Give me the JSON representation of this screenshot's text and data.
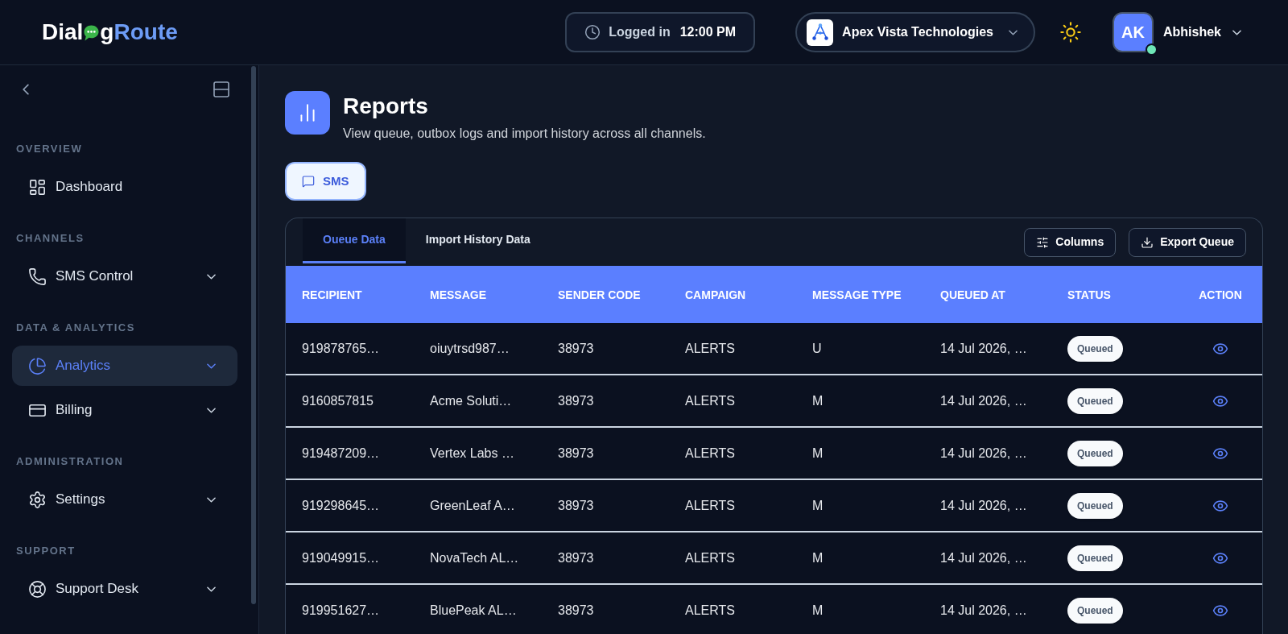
{
  "header": {
    "logo": {
      "lead": "Dial",
      "tail": "g",
      "accent": "Route"
    },
    "session": {
      "label": "Logged in",
      "time": "12:00 PM"
    },
    "organization": {
      "name": "Apex Vista Technologies"
    },
    "user": {
      "initials": "AK",
      "name": "Abhishek",
      "online": true
    }
  },
  "sidebar": {
    "sections": [
      {
        "title": "OVERVIEW",
        "items": [
          {
            "kind": "dashboard",
            "label": "Dashboard",
            "selected": false,
            "expandable": false
          }
        ]
      },
      {
        "title": "CHANNELS",
        "items": [
          {
            "kind": "phone",
            "label": "SMS Control",
            "selected": false,
            "expandable": true
          }
        ]
      },
      {
        "title": "DATA & ANALYTICS",
        "items": [
          {
            "kind": "pie-chart",
            "label": "Analytics",
            "selected": true,
            "expandable": true
          },
          {
            "kind": "credit-card",
            "label": "Billing",
            "selected": false,
            "expandable": true
          }
        ]
      },
      {
        "title": "ADMINISTRATION",
        "items": [
          {
            "kind": "gear",
            "label": "Settings",
            "selected": false,
            "expandable": true
          }
        ]
      },
      {
        "title": "SUPPORT",
        "items": [
          {
            "kind": "lifebuoy",
            "label": "Support Desk",
            "selected": false,
            "expandable": true
          }
        ]
      }
    ]
  },
  "page": {
    "title": "Reports",
    "subtitle": "View queue, outbox logs and import history across all channels."
  },
  "channels": [
    {
      "label": "SMS",
      "selected": true
    }
  ],
  "report_tabs": [
    {
      "label": "Oueue Data",
      "selected": true
    },
    {
      "label": "Import History Data",
      "selected": false
    }
  ],
  "toolbar": [
    {
      "kind": "columns",
      "label": "Columns"
    },
    {
      "kind": "export",
      "label": "Export Queue"
    }
  ],
  "table": {
    "columns": [
      {
        "label": "RECIPIENT",
        "kind": "text"
      },
      {
        "label": "MESSAGE",
        "kind": "text"
      },
      {
        "label": "SENDER CODE",
        "kind": "text"
      },
      {
        "label": "CAMPAIGN",
        "kind": "text"
      },
      {
        "label": "MESSAGE TYPE",
        "kind": "text"
      },
      {
        "label": "QUEUED AT",
        "kind": "text"
      },
      {
        "label": "STATUS",
        "kind": "status"
      },
      {
        "label": "ACTION",
        "kind": "action"
      }
    ],
    "rows": [
      {
        "cells": [
          "919878765…",
          "oiuytrsd987…",
          "38973",
          "ALERTS",
          "U",
          "14 Jul 2026, …",
          "Queued"
        ]
      },
      {
        "cells": [
          "9160857815",
          "Acme Soluti…",
          "38973",
          "ALERTS",
          "M",
          "14 Jul 2026, …",
          "Queued"
        ]
      },
      {
        "cells": [
          "919487209…",
          "Vertex Labs …",
          "38973",
          "ALERTS",
          "M",
          "14 Jul 2026, …",
          "Queued"
        ]
      },
      {
        "cells": [
          "919298645…",
          "GreenLeaf A…",
          "38973",
          "ALERTS",
          "M",
          "14 Jul 2026, …",
          "Queued"
        ]
      },
      {
        "cells": [
          "919049915…",
          "NovaTech AL…",
          "38973",
          "ALERTS",
          "M",
          "14 Jul 2026, …",
          "Queued"
        ]
      },
      {
        "cells": [
          "919951627…",
          "BluePeak AL…",
          "38973",
          "ALERTS",
          "M",
          "14 Jul 2026, …",
          "Queued"
        ]
      }
    ]
  }
}
